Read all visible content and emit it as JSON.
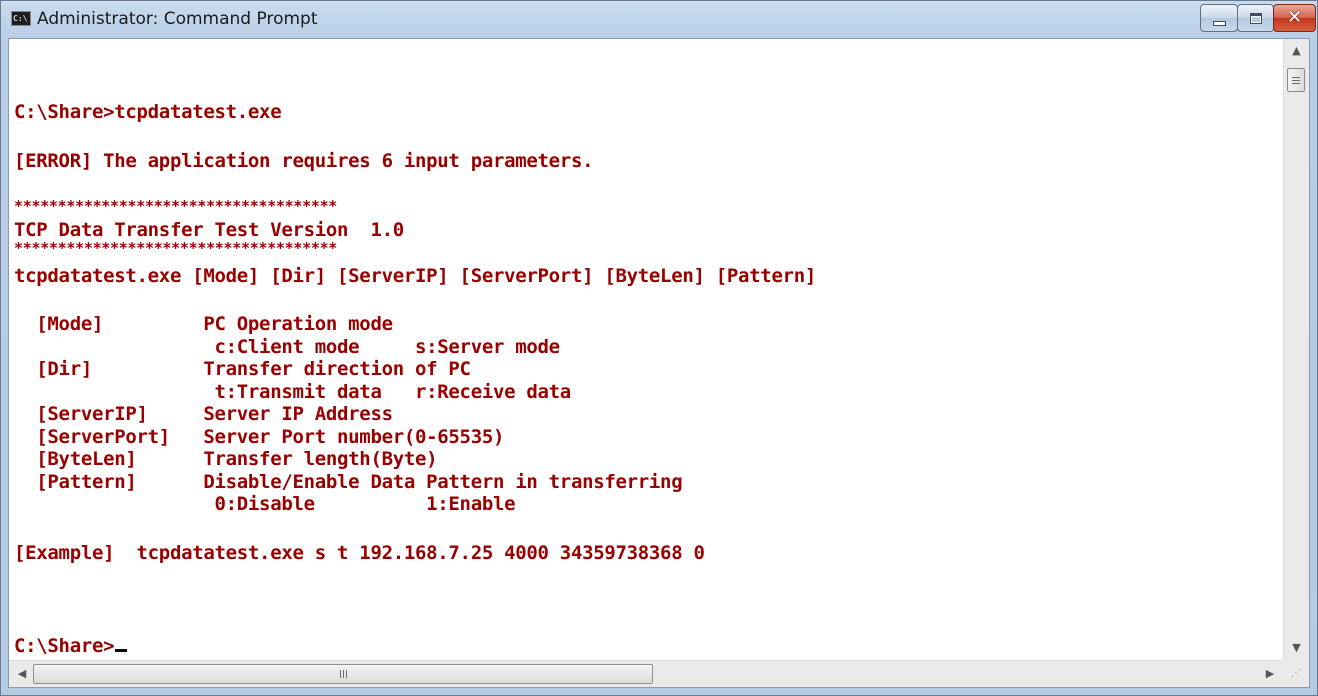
{
  "window": {
    "title": "Administrator: Command Prompt",
    "icon": "cmd-icon"
  },
  "console": {
    "lines": [
      "C:\\Share>tcpdatatest.exe",
      "[ERROR] The application requires 6 input parameters.",
      "*************************************",
      "TCP Data Transfer Test Version  1.0",
      "*************************************",
      "tcpdatatest.exe [Mode] [Dir] [ServerIP] [ServerPort] [ByteLen] [Pattern]",
      "  [Mode]         PC Operation mode",
      "                  c:Client mode     s:Server mode",
      "  [Dir]          Transfer direction of PC",
      "                  t:Transmit data   r:Receive data",
      "  [ServerIP]     Server IP Address",
      "  [ServerPort]   Server Port number(0-65535)",
      "  [ByteLen]      Transfer length(Byte)",
      "  [Pattern]      Disable/Enable Data Pattern in transferring",
      "                  0:Disable          1:Enable",
      "[Example]  tcpdatatest.exe s t 192.168.7.25 4000 34359738368 0",
      "C:\\Share>"
    ],
    "text_color": "#990000",
    "background": "#ffffff"
  },
  "icons": {
    "minimize": "minimize-icon",
    "maximize": "maximize-icon",
    "close": "close-icon",
    "scroll_up": "arrow-up-icon",
    "scroll_down": "arrow-down-icon",
    "scroll_left": "arrow-left-icon",
    "scroll_right": "arrow-right-icon"
  }
}
